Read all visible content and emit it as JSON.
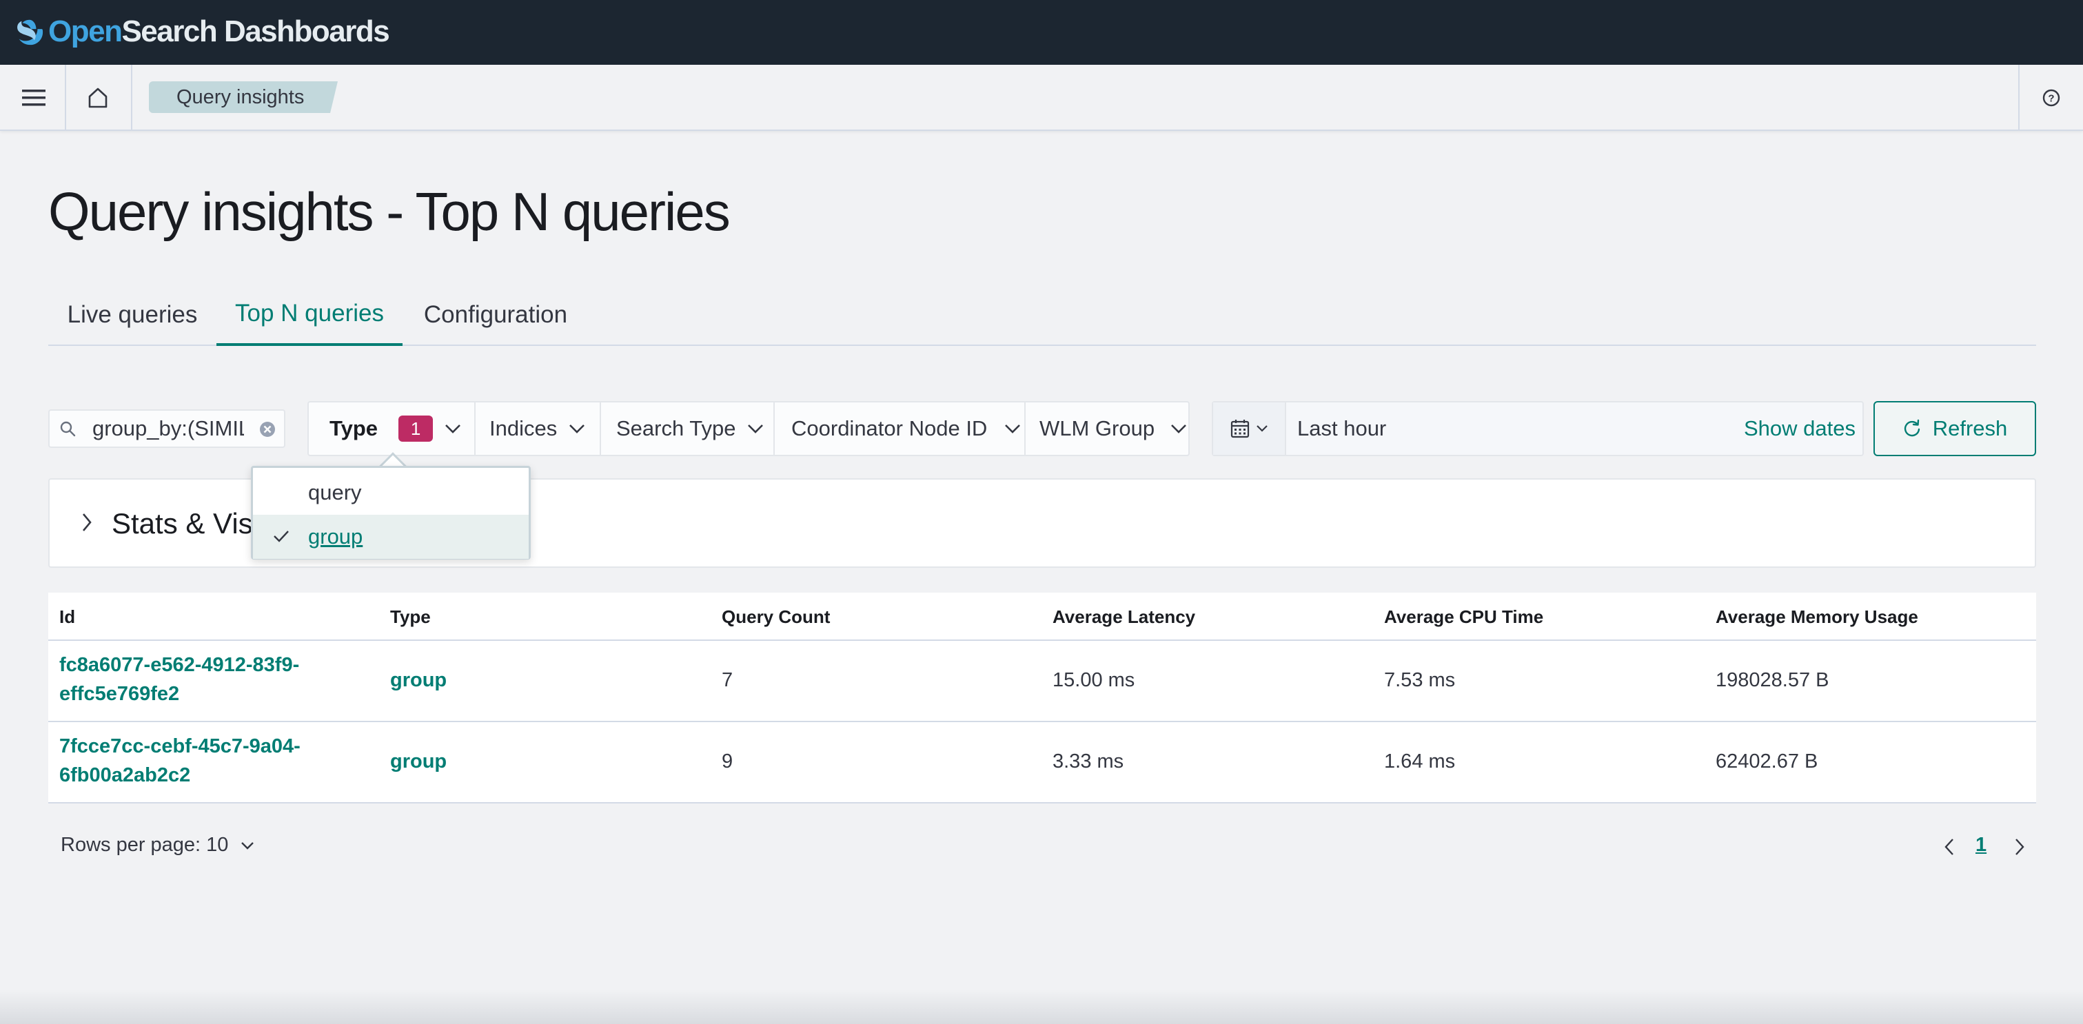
{
  "header": {
    "logo_open": "Open",
    "logo_rest": "Search Dashboards"
  },
  "nav": {
    "breadcrumb": "Query insights"
  },
  "page": {
    "title": "Query insights - Top N queries"
  },
  "tabs": [
    {
      "label": "Live queries",
      "active": false
    },
    {
      "label": "Top N queries",
      "active": true
    },
    {
      "label": "Configuration",
      "active": false
    }
  ],
  "filters": {
    "search_value": "group_by:(SIMIL",
    "type_label": "Type",
    "type_badge": "1",
    "indices_label": "Indices",
    "search_type_label": "Search Type",
    "coordinator_label": "Coordinator Node ID",
    "wlm_label": "WLM Group"
  },
  "date_picker": {
    "range": "Last hour",
    "show_dates": "Show dates"
  },
  "refresh_label": "Refresh",
  "stats_panel": {
    "title": "Stats & Visualizations"
  },
  "type_dropdown": {
    "options": [
      {
        "label": "query",
        "selected": false
      },
      {
        "label": "group",
        "selected": true
      }
    ]
  },
  "table": {
    "columns": [
      "Id",
      "Type",
      "Query Count",
      "Average Latency",
      "Average CPU Time",
      "Average Memory Usage"
    ],
    "rows": [
      {
        "id": "fc8a6077-e562-4912-83f9-effc5e769fe2",
        "type": "group",
        "query_count": "7",
        "avg_latency": "15.00 ms",
        "avg_cpu": "7.53 ms",
        "avg_memory": "198028.57 B"
      },
      {
        "id": "7fcce7cc-cebf-45c7-9a04-6fb00a2ab2c2",
        "type": "group",
        "query_count": "9",
        "avg_latency": "3.33 ms",
        "avg_cpu": "1.64 ms",
        "avg_memory": "62402.67 B"
      }
    ]
  },
  "pagination": {
    "rows_per_page": "Rows per page: 10",
    "current_page": "1"
  },
  "colors": {
    "accent": "#017d73",
    "header_bg": "#1c2631",
    "badge": "#bd2b64"
  }
}
